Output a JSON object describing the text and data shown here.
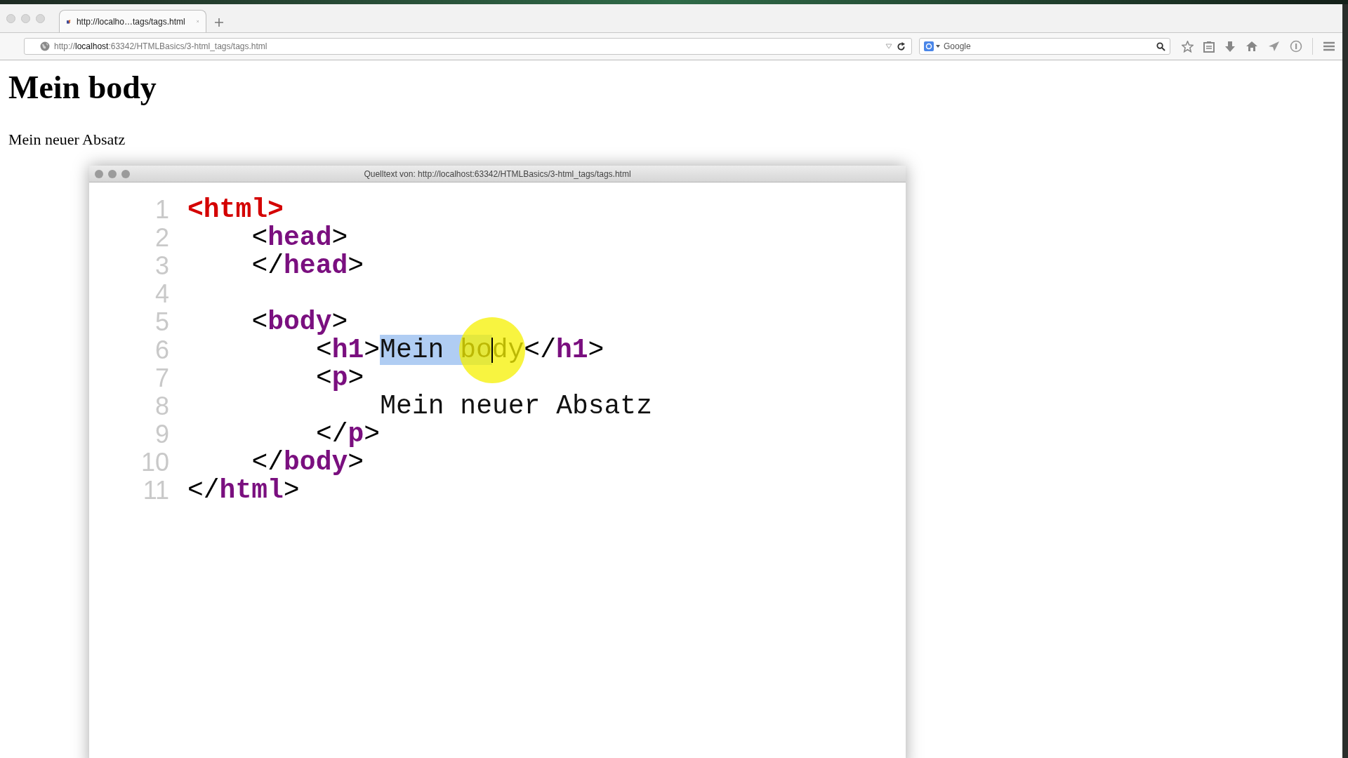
{
  "browser": {
    "tab": {
      "title": "http://localho…tags/tags.html"
    },
    "address_bar": {
      "scheme": "http://",
      "host": "localhost",
      "path": ":63342/HTMLBasics/3-html_tags/tags.html"
    },
    "search_field": {
      "placeholder": "Google"
    }
  },
  "page": {
    "heading": "Mein body",
    "paragraph": "Mein neuer Absatz"
  },
  "source_window": {
    "title": "Quelltext von: http://localhost:63342/HTMLBasics/3-html_tags/tags.html",
    "lines": [
      {
        "number": "1",
        "tokens": [
          {
            "text": "<html>",
            "kind": "root",
            "selected": false
          }
        ],
        "children": [
          {
            "number": "2",
            "tokens": [
              {
                "text": "<",
                "kind": "punct",
                "selected": false
              },
              {
                "text": "head",
                "kind": "tag",
                "selected": false
              },
              {
                "text": ">",
                "kind": "punct",
                "selected": false
              }
            ]
          },
          {
            "number": "3",
            "tokens": [
              {
                "text": "</",
                "kind": "punct",
                "selected": false
              },
              {
                "text": "head",
                "kind": "tag",
                "selected": false
              },
              {
                "text": ">",
                "kind": "punct",
                "selected": false
              }
            ]
          },
          {
            "number": "4"
          },
          {
            "number": "5",
            "tokens": [
              {
                "text": "<",
                "kind": "punct",
                "selected": false
              },
              {
                "text": "body",
                "kind": "tag",
                "selected": false
              },
              {
                "text": ">",
                "kind": "punct",
                "selected": false
              }
            ],
            "children": [
              {
                "number": "6",
                "tokens": [
                  {
                    "text": "<",
                    "kind": "punct",
                    "selected": false
                  },
                  {
                    "text": "h1",
                    "kind": "tag",
                    "selected": false
                  },
                  {
                    "text": ">",
                    "kind": "punct",
                    "selected": false
                  },
                  {
                    "text": "Mein bo",
                    "kind": "plain",
                    "selected": true
                  },
                  {
                    "text": "dy",
                    "kind": "plain",
                    "selected": false
                  },
                  {
                    "text": "</",
                    "kind": "punct",
                    "selected": false
                  },
                  {
                    "text": "h1",
                    "kind": "tag",
                    "selected": false
                  },
                  {
                    "text": ">",
                    "kind": "punct",
                    "selected": false
                  }
                ]
              },
              {
                "number": "7",
                "tokens": [
                  {
                    "text": "<",
                    "kind": "punct",
                    "selected": false
                  },
                  {
                    "text": "p",
                    "kind": "tag",
                    "selected": false
                  },
                  {
                    "text": ">",
                    "kind": "punct",
                    "selected": false
                  }
                ],
                "children": [
                  {
                    "number": "8",
                    "tokens": [
                      {
                        "text": "Mein neuer Absatz",
                        "kind": "plain",
                        "selected": false
                      }
                    ]
                  }
                ]
              },
              {
                "number": "9",
                "tokens": [
                  {
                    "text": "</",
                    "kind": "punct",
                    "selected": false
                  },
                  {
                    "text": "p",
                    "kind": "tag",
                    "selected": false
                  },
                  {
                    "text": ">",
                    "kind": "punct",
                    "selected": false
                  }
                ]
              }
            ]
          },
          {
            "number": "10",
            "tokens": [
              {
                "text": "</",
                "kind": "punct",
                "selected": false
              },
              {
                "text": "body",
                "kind": "tag",
                "selected": false
              },
              {
                "text": ">",
                "kind": "punct",
                "selected": false
              }
            ]
          }
        ]
      },
      {
        "number": "11",
        "tokens": [
          {
            "text": "</",
            "kind": "punct",
            "selected": false
          },
          {
            "text": "html",
            "kind": "tag",
            "selected": false
          },
          {
            "text": ">",
            "kind": "punct",
            "selected": false
          }
        ]
      }
    ]
  }
}
